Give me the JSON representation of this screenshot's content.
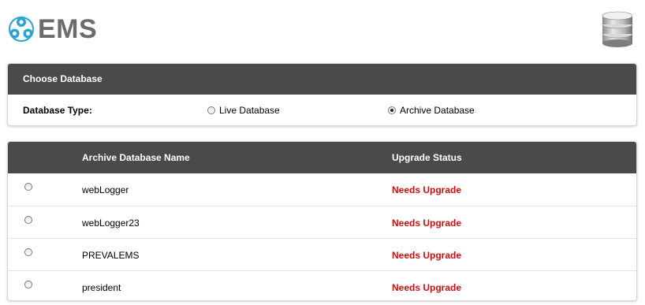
{
  "header": {
    "app_name": "EMS",
    "logo_icon": "ems-logo-icon",
    "database_icon": "database-icon"
  },
  "choose_database": {
    "title": "Choose Database",
    "type_label": "Database Type:",
    "options": [
      {
        "label": "Live Database",
        "selected": false
      },
      {
        "label": "Archive Database",
        "selected": true
      }
    ]
  },
  "archive_table": {
    "columns": [
      "Archive Database Name",
      "Upgrade Status"
    ],
    "rows": [
      {
        "name": "webLogger",
        "status": "Needs Upgrade",
        "selected": false
      },
      {
        "name": "webLogger23",
        "status": "Needs Upgrade",
        "selected": false
      },
      {
        "name": "PREVALEMS",
        "status": "Needs Upgrade",
        "selected": false
      },
      {
        "name": "president",
        "status": "Needs Upgrade",
        "selected": false
      }
    ]
  },
  "colors": {
    "panel_header": "#4a4a4a",
    "status_text": "#d00d0d",
    "logo_blue": "#29a3d6",
    "logo_text": "#6b6b6b"
  }
}
